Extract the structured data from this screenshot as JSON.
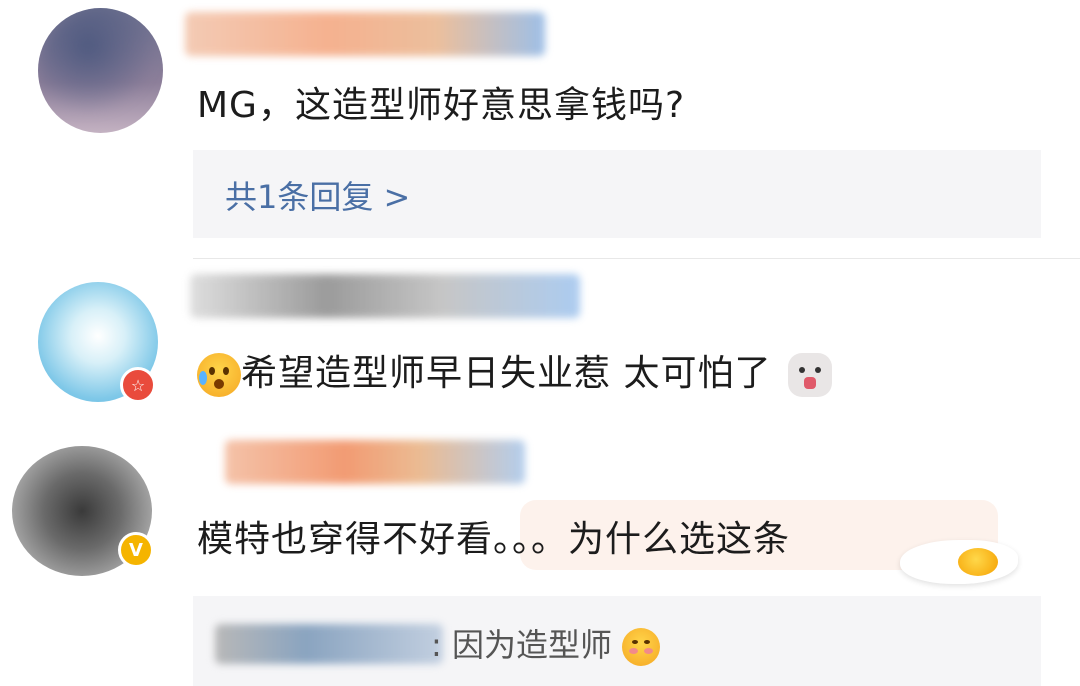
{
  "comments": [
    {
      "text": "MG，这造型师好意思拿钱吗?",
      "reply_count_label": "共1条回复 >"
    },
    {
      "text": "希望造型师早日失业惹 太可怕了"
    },
    {
      "text": "模特也穿得不好看。。。为什么选这条",
      "reply_text": ": 因为造型师"
    }
  ],
  "colors": {
    "link": "#4a6fa5",
    "reply_bg": "#f5f5f7",
    "highlight_bg": "#fdf1ea",
    "badge_red": "#e94b3c",
    "badge_gold": "#f5b400"
  },
  "icons": [
    "surprised-cry-emoji",
    "alpaca-emoji",
    "egg-sticker",
    "shy-emoji",
    "star-badge-icon",
    "verified-v-icon"
  ]
}
